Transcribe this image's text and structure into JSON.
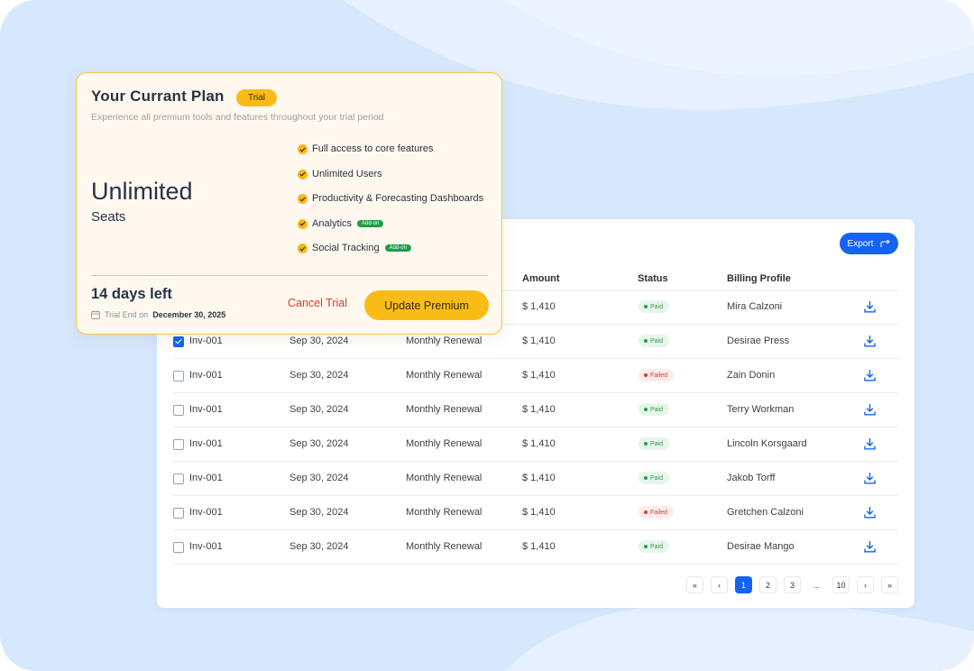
{
  "plan": {
    "title": "Your Currant Plan",
    "badge": "Trial",
    "subtitle": "Experience all premium tools and features throughout your trial period",
    "seats_value": "Unlimited",
    "seats_label": "Seats",
    "features": [
      {
        "label": "Full access to core features",
        "addon": ""
      },
      {
        "label": "Unlimited Users",
        "addon": ""
      },
      {
        "label": "Productivity & Forecasting Dashboards",
        "addon": ""
      },
      {
        "label": "Analytics",
        "addon": "Add-on"
      },
      {
        "label": "Social Tracking",
        "addon": "Add-on"
      }
    ],
    "days_left": "14 days left",
    "trial_end_prefix": "Trial End on",
    "trial_end_date": "December 30, 2025",
    "cancel_label": "Cancel Trial",
    "update_label": "Update Premium",
    "accent_color": "#f9bc17"
  },
  "table": {
    "export_label": "Export",
    "columns": {
      "amount": "Amount",
      "status": "Status",
      "billing": "Billing Profile"
    },
    "rows": [
      {
        "invoice": "",
        "date": "",
        "type": "",
        "amount": "$ 1,410",
        "status": "Paid",
        "billing": "Mira Calzoni",
        "checked": false
      },
      {
        "invoice": "Inv-001",
        "date": "Sep 30, 2024",
        "type": "Monthly Renewal",
        "amount": "$ 1,410",
        "status": "Paid",
        "billing": "Desirae Press",
        "checked": true
      },
      {
        "invoice": "Inv-001",
        "date": "Sep 30, 2024",
        "type": "Monthly Renewal",
        "amount": "$ 1,410",
        "status": "Failed",
        "billing": "Zain Donin",
        "checked": false
      },
      {
        "invoice": "Inv-001",
        "date": "Sep 30, 2024",
        "type": "Monthly Renewal",
        "amount": "$ 1,410",
        "status": "Paid",
        "billing": "Terry Workman",
        "checked": false
      },
      {
        "invoice": "Inv-001",
        "date": "Sep 30, 2024",
        "type": "Monthly Renewal",
        "amount": "$ 1,410",
        "status": "Paid",
        "billing": "Lincoln Korsgaard",
        "checked": false
      },
      {
        "invoice": "Inv-001",
        "date": "Sep 30, 2024",
        "type": "Monthly Renewal",
        "amount": "$ 1,410",
        "status": "Paid",
        "billing": "Jakob Torff",
        "checked": false
      },
      {
        "invoice": "Inv-001",
        "date": "Sep 30, 2024",
        "type": "Monthly Renewal",
        "amount": "$ 1,410",
        "status": "Failed",
        "billing": "Gretchen Calzoni",
        "checked": false
      },
      {
        "invoice": "Inv-001",
        "date": "Sep 30, 2024",
        "type": "Monthly Renewal",
        "amount": "$ 1,410",
        "status": "Paid",
        "billing": "Desirae Mango",
        "checked": false
      }
    ]
  },
  "pagination": {
    "first": "«",
    "prev": "‹",
    "pages": [
      "1",
      "2",
      "3"
    ],
    "ellipsis": "...",
    "last_page": "10",
    "next": "›",
    "last": "»",
    "current": "1"
  },
  "colors": {
    "primary": "#1463f3",
    "paid": "#2e9b4a",
    "failed": "#d93a2f",
    "background": "#d7e8fd"
  }
}
